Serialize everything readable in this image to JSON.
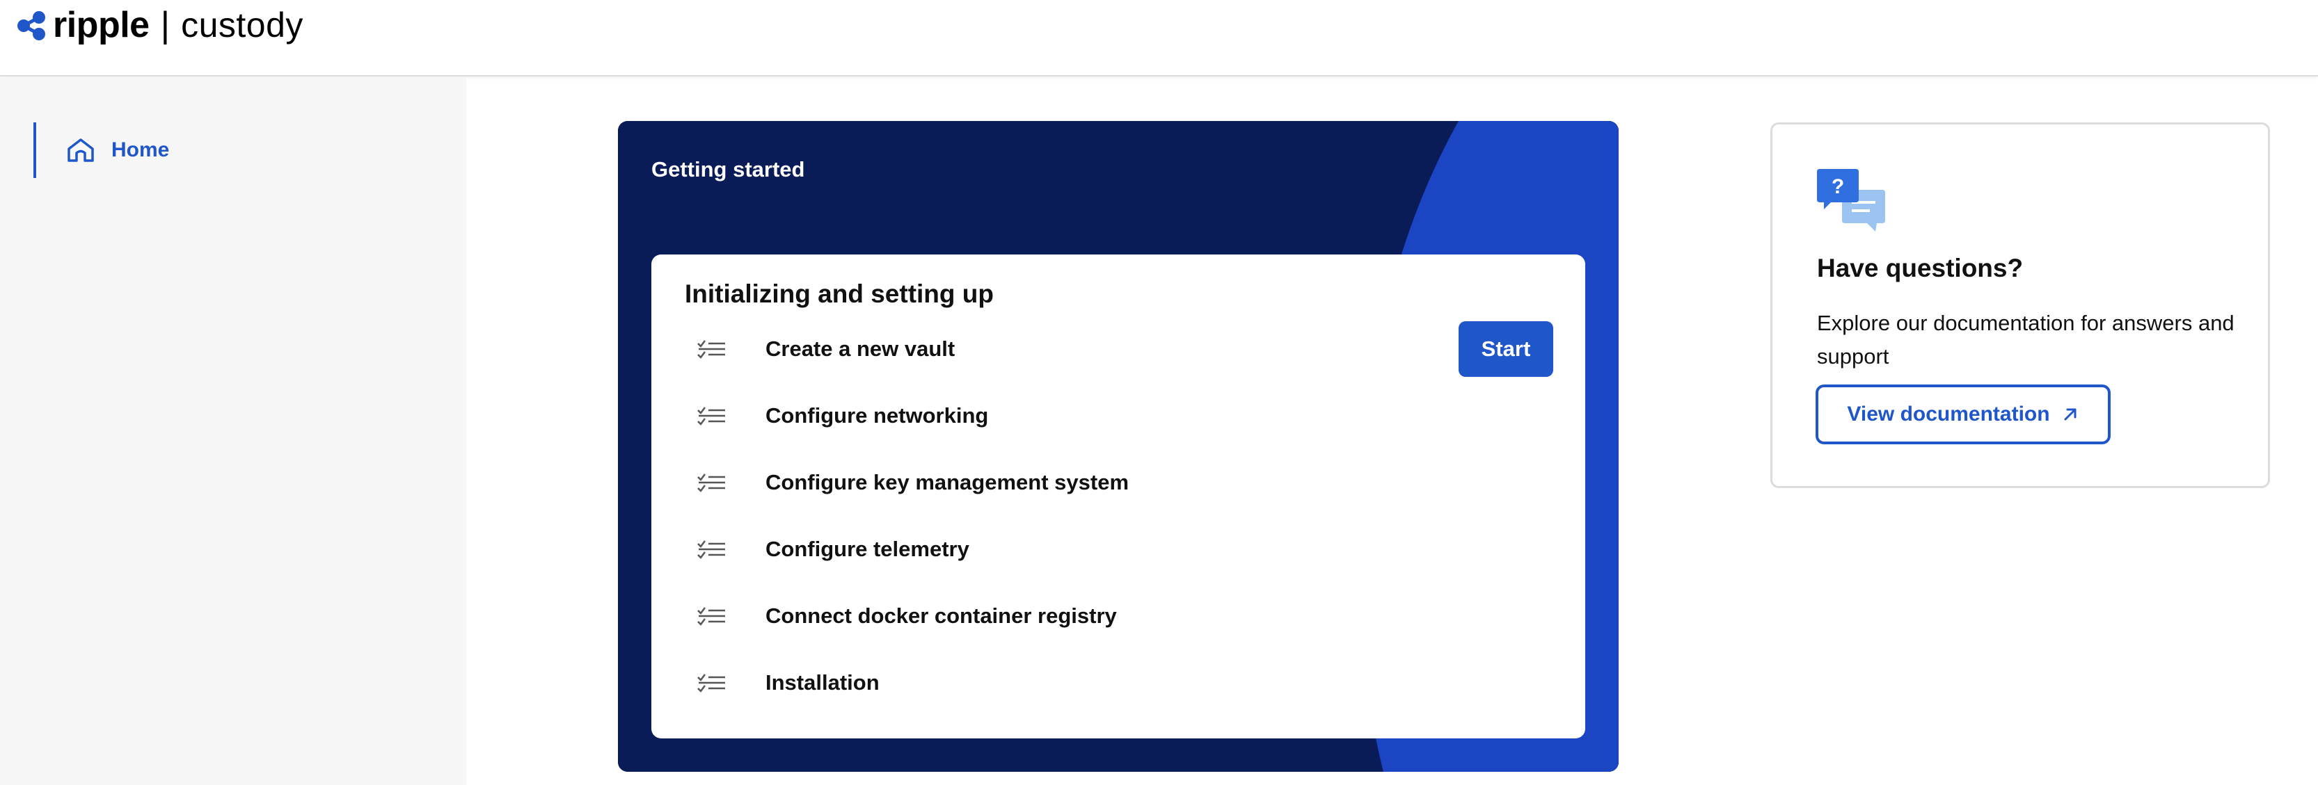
{
  "brand": {
    "name": "ripple",
    "separator": "|",
    "product": "custody",
    "logo_icon": "ripple-logo-icon",
    "accent_color": "#1f56c9"
  },
  "sidebar": {
    "items": [
      {
        "label": "Home",
        "icon": "home-icon",
        "active": true
      }
    ]
  },
  "getting_started": {
    "title": "Getting started",
    "background_color": "#0a1c57",
    "panel": {
      "title": "Initializing and setting up",
      "start_label": "Start",
      "tasks": [
        {
          "label": "Create a new vault",
          "icon": "checklist-icon"
        },
        {
          "label": "Configure networking",
          "icon": "checklist-icon"
        },
        {
          "label": "Configure key management system",
          "icon": "checklist-icon"
        },
        {
          "label": "Configure telemetry",
          "icon": "checklist-icon"
        },
        {
          "label": "Connect docker container registry",
          "icon": "checklist-icon"
        },
        {
          "label": "Installation",
          "icon": "checklist-icon"
        }
      ]
    }
  },
  "questions": {
    "icon": "chat-question-icon",
    "title": "Have questions?",
    "text": "Explore our documentation for answers and support",
    "button_label": "View documentation",
    "button_icon": "external-link-icon"
  }
}
